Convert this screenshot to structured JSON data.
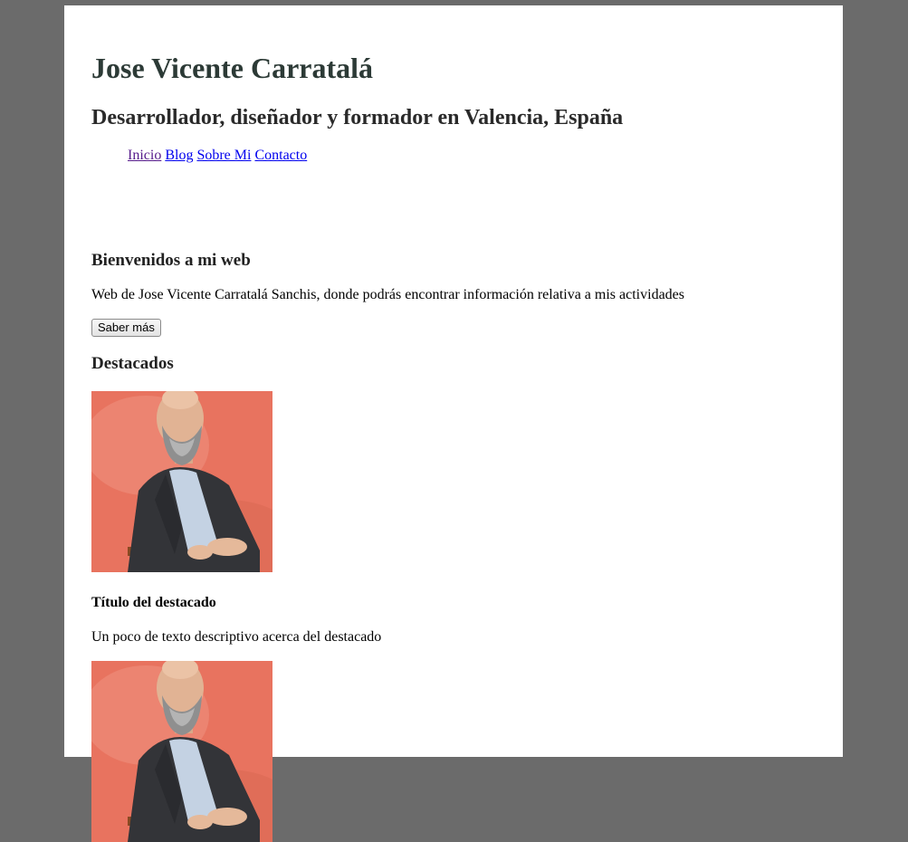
{
  "header": {
    "title": "Jose Vicente Carratalá",
    "subtitle": "Desarrollador, diseñador y formador en Valencia, España"
  },
  "nav": {
    "items": [
      {
        "label": "Inicio"
      },
      {
        "label": "Blog"
      },
      {
        "label": "Sobre Mi"
      },
      {
        "label": "Contacto"
      }
    ]
  },
  "welcome": {
    "heading": "Bienvenidos a mi web",
    "text": "Web de Jose Vicente Carratalá Sanchis, donde podrás encontrar información relativa a mis actividades",
    "button_label": "Saber más"
  },
  "featured": {
    "heading": "Destacados",
    "items": [
      {
        "title": "Título del destacado",
        "description": "Un poco de texto descriptivo acerca del destacado"
      },
      {
        "title": "",
        "description": ""
      }
    ]
  },
  "colors": {
    "window_background": "#6b6b6b",
    "page_background": "#ffffff",
    "title_color": "#2c3a36",
    "link": "#0000ee",
    "visited_link": "#551a8b",
    "photo_background": "#e8735f"
  }
}
